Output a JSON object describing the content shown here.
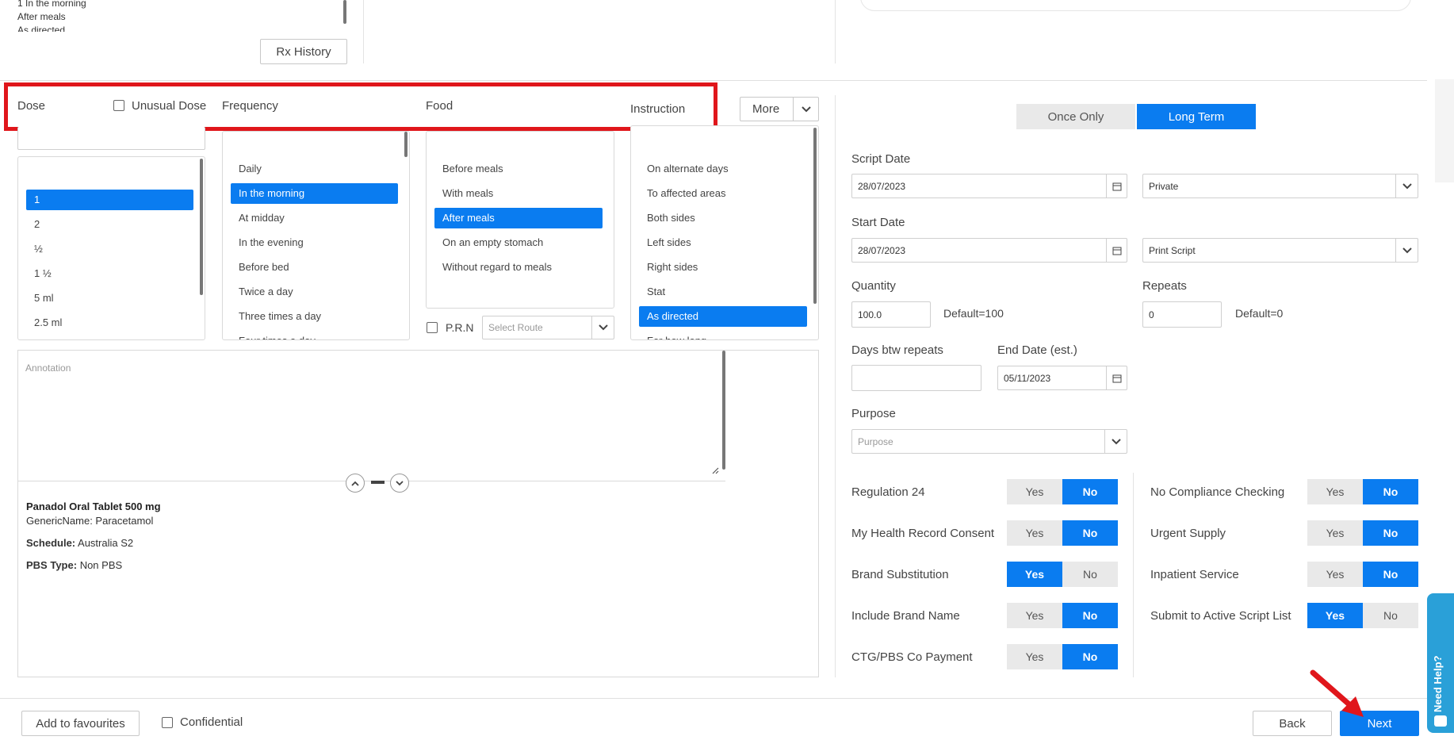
{
  "top": {
    "history_items": [
      "1 In the morning",
      "After meals",
      "As directed"
    ],
    "rx_history_label": "Rx History"
  },
  "headers": {
    "dose": "Dose",
    "unusual_dose": "Unusual Dose",
    "frequency": "Frequency",
    "food": "Food",
    "instruction": "Instruction",
    "more": "More"
  },
  "dose_list": {
    "items": [
      "1",
      "2",
      "½",
      "1 ½",
      "5 ml",
      "2.5 ml"
    ],
    "selected": "1"
  },
  "frequency_list": {
    "items": [
      "Daily",
      "In the morning",
      "At midday",
      "In the evening",
      "Before bed",
      "Twice a day",
      "Three times a day",
      "Four times a day"
    ],
    "selected": "In the morning"
  },
  "food_list": {
    "items": [
      "Before meals",
      "With meals",
      "After meals",
      "On an empty stomach",
      "Without regard to meals"
    ],
    "selected": "After meals"
  },
  "instruction_list": {
    "items": [
      "On alternate days",
      "To affected areas",
      "Both sides",
      "Left sides",
      "Right sides",
      "Stat",
      "As directed",
      "For how long"
    ],
    "selected": "As directed"
  },
  "prn_label": "P.R.N",
  "route_placeholder": "Select Route",
  "annotation_placeholder": "Annotation",
  "drug": {
    "name": "Panadol Oral Tablet 500 mg",
    "generic": "GenericName: Paracetamol",
    "schedule_label": "Schedule:",
    "schedule_value": "Australia S2",
    "pbs_label": "PBS Type:",
    "pbs_value": "Non PBS"
  },
  "right": {
    "once_only": "Once Only",
    "long_term": "Long Term",
    "script_date_label": "Script Date",
    "script_date": "28/07/2023",
    "private": "Private",
    "start_date_label": "Start Date",
    "start_date": "28/07/2023",
    "print_script": "Print Script",
    "quantity_label": "Quantity",
    "quantity": "100.0",
    "quantity_default": "Default=100",
    "repeats_label": "Repeats",
    "repeats": "0",
    "repeats_default": "Default=0",
    "days_btw_label": "Days btw repeats",
    "end_date_label": "End Date (est.)",
    "end_date": "05/11/2023",
    "purpose_label": "Purpose",
    "purpose_placeholder": "Purpose",
    "yes": "Yes",
    "no": "No",
    "toggles_left": [
      {
        "label": "Regulation 24",
        "value": "No"
      },
      {
        "label": "My Health Record Consent",
        "value": "No"
      },
      {
        "label": "Brand Substitution",
        "value": "Yes"
      },
      {
        "label": "Include Brand Name",
        "value": "No"
      },
      {
        "label": "CTG/PBS Co Payment",
        "value": "No"
      }
    ],
    "toggles_right": [
      {
        "label": "No Compliance Checking",
        "value": "No"
      },
      {
        "label": "Urgent Supply",
        "value": "No"
      },
      {
        "label": "Inpatient Service",
        "value": "No"
      },
      {
        "label": "Submit to Active Script List",
        "value": "Yes"
      }
    ]
  },
  "footer": {
    "add_favourites": "Add to favourites",
    "confidential": "Confidential",
    "back": "Back",
    "next": "Next"
  },
  "help_tab": "Need Help?",
  "colors": {
    "accent": "#0a7cf0",
    "highlight_box": "#e0161b",
    "arrow": "#e0161b"
  }
}
